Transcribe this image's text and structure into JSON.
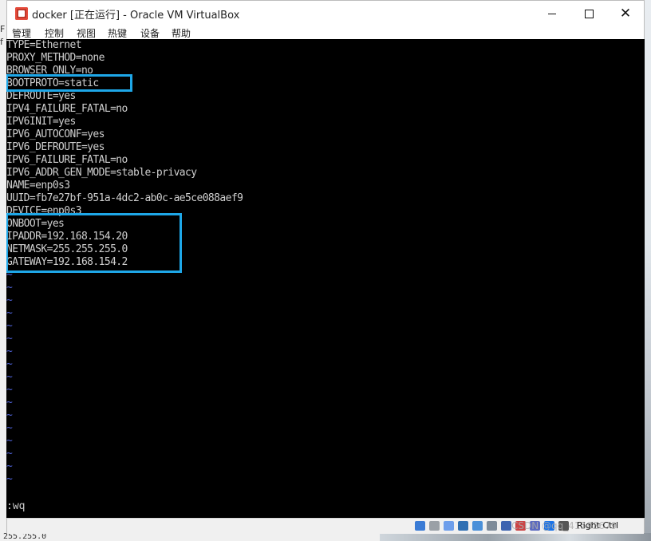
{
  "window": {
    "title": "docker [正在运行] - Oracle VM VirtualBox",
    "menu": [
      "管理",
      "控制",
      "视图",
      "热键",
      "设备",
      "帮助"
    ]
  },
  "desktop": {
    "left_fragments": [
      "F",
      "f"
    ],
    "bottom_fragment": "255.255.0"
  },
  "console": {
    "lines": [
      "TYPE=Ethernet",
      "PROXY_METHOD=none",
      "BROWSER_ONLY=no",
      "BOOTPROTO=static",
      "DEFROUTE=yes",
      "IPV4_FAILURE_FATAL=no",
      "IPV6INIT=yes",
      "IPV6_AUTOCONF=yes",
      "IPV6_DEFROUTE=yes",
      "IPV6_FAILURE_FATAL=no",
      "IPV6_ADDR_GEN_MODE=stable-privacy",
      "NAME=enp0s3",
      "UUID=fb7e27bf-951a-4dc2-ab0c-ae5ce088aef9",
      "DEVICE=enp0s3",
      "ONBOOT=yes",
      "IPADDR=192.168.154.20",
      "NETMASK=255.255.255.0",
      "GATEWAY=192.168.154.2"
    ],
    "empty_line_marker": "~",
    "empty_line_count": 17,
    "command": ":wq",
    "tilde_color": "#4f63d8",
    "highlight_color": "#1ea7e8"
  },
  "statusbar": {
    "host_key": "Right Ctrl",
    "watermark": "CSDN @qq_41582679",
    "icons": [
      "hard-disk-icon",
      "optical-drive-icon",
      "audio-icon",
      "network-icon",
      "usb-icon",
      "shared-folders-icon",
      "display-icon",
      "video-capture-icon",
      "cpu-icon",
      "mouse-integration-icon",
      "host-key-icon"
    ]
  }
}
